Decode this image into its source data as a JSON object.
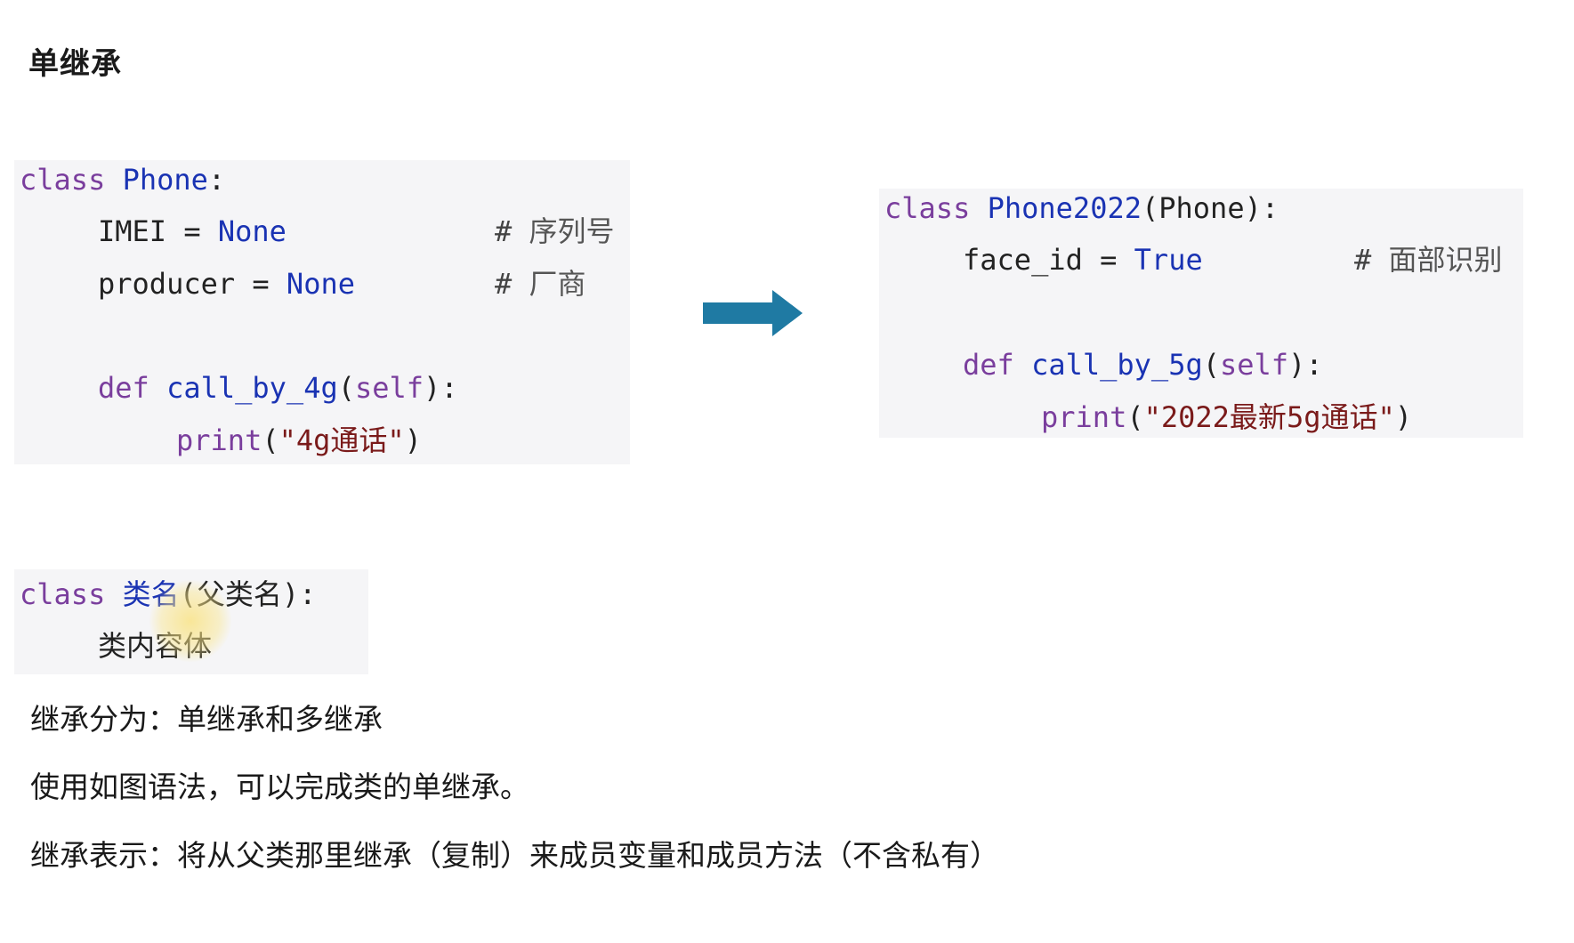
{
  "page": {
    "title": "单继承"
  },
  "block1": {
    "l1": {
      "kw": "class",
      "name": "Phone",
      "colon": ":"
    },
    "l2": {
      "var": "IMEI",
      "eq": "=",
      "val": "None",
      "hash": "#",
      "comment": "序列号"
    },
    "l3": {
      "var": "producer",
      "eq": "=",
      "val": "None",
      "hash": "#",
      "comment": "厂商"
    },
    "l4": {
      "kw": "def",
      "fn": "call_by_4g",
      "open": "(",
      "self": "self",
      "close": "):"
    },
    "l5": {
      "fn": "print",
      "open": "(",
      "str_q1": "\"",
      "str_a": "4g",
      "str_cn": "通话",
      "str_q2": "\"",
      "close": ")"
    }
  },
  "block2": {
    "l1": {
      "kw": "class",
      "name": "Phone2022",
      "open": "(",
      "parent": "Phone",
      "close": "):"
    },
    "l2": {
      "var": "face_id",
      "eq": "=",
      "val": "True",
      "hash": "#",
      "comment": "面部识别"
    },
    "l3": {
      "kw": "def",
      "fn": "call_by_5g",
      "open": "(",
      "self": "self",
      "close": "):"
    },
    "l4": {
      "fn": "print",
      "open": "(",
      "str_q1": "\"",
      "str_a": "2022",
      "str_cn1": "最新",
      "str_b": "5g",
      "str_cn2": "通话",
      "str_q2": "\"",
      "close": ")"
    }
  },
  "block3": {
    "l1": {
      "kw": "class",
      "name": "类名",
      "open": "(",
      "parent": "父类名",
      "close": "):"
    },
    "l2": {
      "body": "类内容体"
    }
  },
  "arrow": {
    "color": "#1f7aa3",
    "icon": "right-arrow-icon"
  },
  "paragraphs": {
    "p1": "继承分为：单继承和多继承",
    "p2": "使用如图语法，可以完成类的单继承。",
    "p3": "继承表示：将从父类那里继承（复制）来成员变量和成员方法（不含私有）"
  }
}
